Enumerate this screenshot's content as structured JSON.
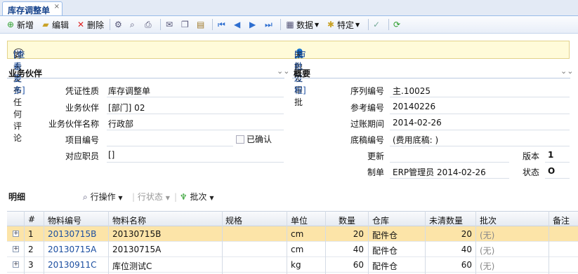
{
  "tab": {
    "label": "库存调整单",
    "close": "×"
  },
  "toolbar": {
    "add": "新增",
    "edit": "编辑",
    "delete": "删除",
    "data": "数据",
    "special": "特定"
  },
  "notice": {
    "comment_text": "尚未发布任何评论",
    "comment_link": "[查看更多]",
    "approval_text": "未触发审批",
    "approval_link": "[审批过程]"
  },
  "partner": {
    "title": "业务伙伴",
    "voucher_type_label": "凭证性质",
    "voucher_type_value": "库存调整单",
    "partner_label": "业务伙伴",
    "partner_value": "[部门] 02",
    "partner_name_label": "业务伙伴名称",
    "partner_name_value": "行政部",
    "project_label": "项目编号",
    "confirmed_label": "已确认",
    "staff_label": "对应职员",
    "staff_value": "[]"
  },
  "summary": {
    "title": "概要",
    "serial_label": "序列编号",
    "serial_value": "主.10025",
    "ref_label": "参考编号",
    "ref_value": "20140226",
    "period_label": "过账期间",
    "period_value": "2014-02-26",
    "draft_label": "底稿编号",
    "draft_value": "(费用底稿: )",
    "update_label": "更新",
    "version_label": "版本",
    "version_value": "1",
    "creator_label": "制单",
    "creator_value": "ERP管理员 2014-02-26",
    "status_label": "状态",
    "status_value": "O"
  },
  "detail": {
    "title": "明细",
    "row_ops": "行操作",
    "row_status": "行状态",
    "batch": "批次",
    "columns": [
      "#",
      "物料编号",
      "物料名称",
      "规格",
      "单位",
      "数量",
      "仓库",
      "未清数量",
      "批次",
      "备注"
    ],
    "rows": [
      {
        "no": "1",
        "code": "20130715B",
        "name": "20130715B",
        "spec": "",
        "unit": "cm",
        "qty": "20",
        "wh": "配件仓",
        "open": "20",
        "batch": "(无)",
        "note": ""
      },
      {
        "no": "2",
        "code": "20130715A",
        "name": "20130715A",
        "spec": "",
        "unit": "cm",
        "qty": "40",
        "wh": "配件仓",
        "open": "40",
        "batch": "(无)",
        "note": ""
      },
      {
        "no": "3",
        "code": "20130911C",
        "name": "库位测试C",
        "spec": "",
        "unit": "kg",
        "qty": "60",
        "wh": "配件仓",
        "open": "60",
        "batch": "(无)",
        "note": ""
      }
    ]
  },
  "colors": {
    "accent": "#15428b",
    "link": "#1b4ea0",
    "selected_row": "#fce4a8",
    "notice_bg": "#fffbd9"
  }
}
